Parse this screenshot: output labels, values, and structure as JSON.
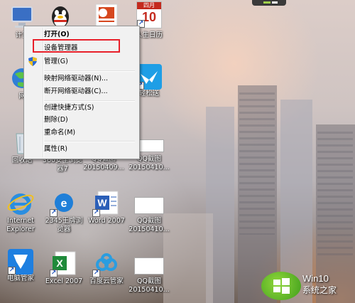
{
  "desktop": {
    "icons": [
      {
        "label": "计算",
        "icon": "computer-icon"
      },
      {
        "label": "",
        "icon": "qq-icon"
      },
      {
        "label": "",
        "icon": "powerpoint-icon"
      },
      {
        "label": "人生日历",
        "icon": "calendar-icon",
        "month": "四月",
        "day": "10"
      },
      {
        "label": "网",
        "icon": "network-icon"
      },
      {
        "label": "轻松送",
        "icon": "bird-app-icon"
      },
      {
        "label": "回收站",
        "icon": "recycle-bin-icon"
      },
      {
        "label": "360安全浏览器7",
        "line1": "360安全浏览",
        "line2": "器7",
        "icon": "360-browser-icon"
      },
      {
        "label": "QQ截图20150409...",
        "line1": "QQ截图",
        "line2": "20150409...",
        "icon": "screenshot-file-icon"
      },
      {
        "label": "QQ截图20150410...",
        "line1": "QQ截图",
        "line2": "20150410...",
        "icon": "screenshot-file-icon"
      },
      {
        "label": "Internet Explorer",
        "line1": "Internet",
        "line2": "Explorer",
        "icon": "ie-icon"
      },
      {
        "label": "2345王牌浏览器",
        "line1": "2345王牌浏",
        "line2": "览器",
        "icon": "2345-browser-icon"
      },
      {
        "label": "Word 2007",
        "icon": "word-icon"
      },
      {
        "label": "QQ截图20150410...",
        "line1": "QQ截图",
        "line2": "20150410...",
        "icon": "screenshot-file-icon"
      },
      {
        "label": "电脑管家",
        "icon": "pc-manager-icon"
      },
      {
        "label": "Excel 2007",
        "icon": "excel-icon"
      },
      {
        "label": "百度云管家",
        "icon": "baidu-cloud-icon"
      },
      {
        "label": "QQ截图20150410...",
        "line1": "QQ截图",
        "line2": "20150410...",
        "icon": "screenshot-file-icon"
      }
    ]
  },
  "context_menu": {
    "items": [
      {
        "label": "打开(O)",
        "bold": true
      },
      {
        "label": "设备管理器",
        "highlighted": true
      },
      {
        "label": "管理(G)",
        "icon": "shield-icon"
      },
      {
        "label": "映射网络驱动器(N)..."
      },
      {
        "label": "断开网络驱动器(C)..."
      },
      {
        "label": "创建快捷方式(S)"
      },
      {
        "label": "删除(D)"
      },
      {
        "label": "重命名(M)"
      },
      {
        "label": "属性(R)"
      }
    ]
  },
  "watermark": {
    "brand": "Win10",
    "site": "系统之家"
  },
  "colors": {
    "highlight_border": "#e8202a",
    "menu_bg": "#f1f1f1"
  }
}
